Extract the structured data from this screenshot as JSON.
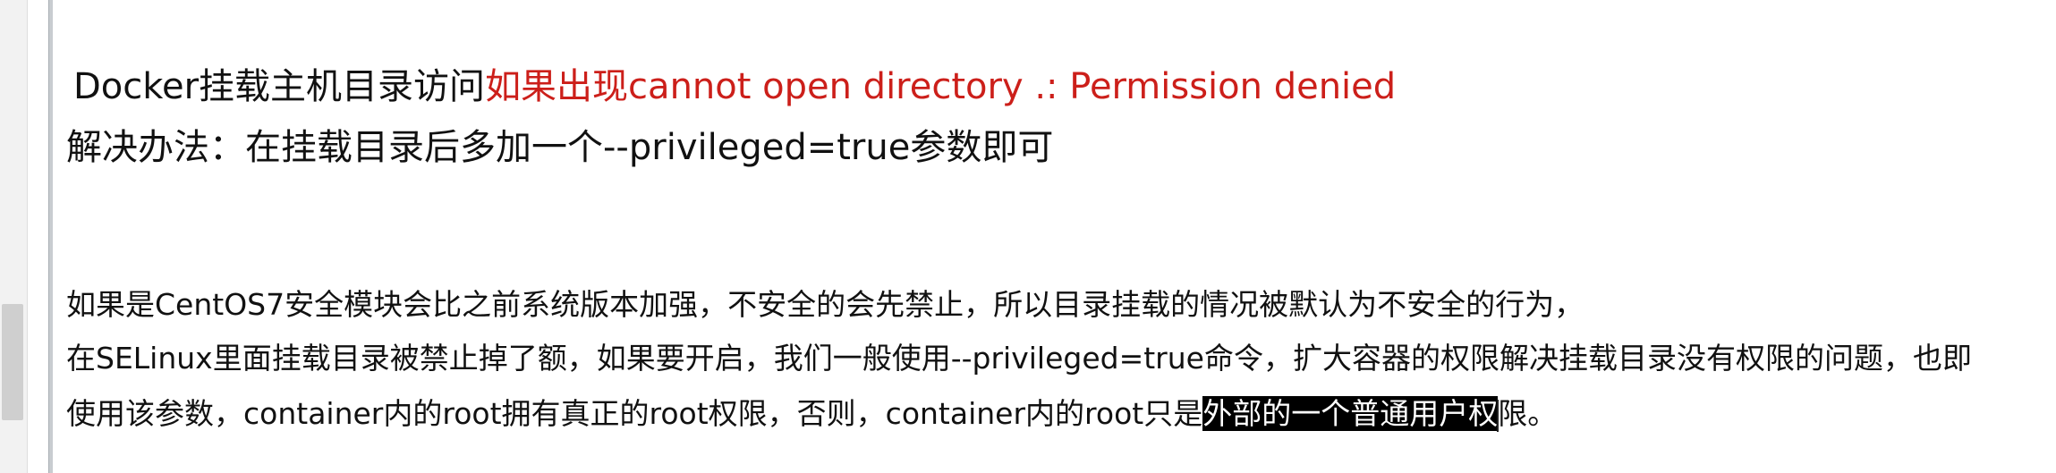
{
  "doc": {
    "heading_prefix": "Docker挂载主机目录访问",
    "heading_red": "如果出现cannot open directory .: Permission denied",
    "solution": "解决办法：在挂载目录后多加一个--privileged=true参数即可",
    "para_line1": "如果是CentOS7安全模块会比之前系统版本加强，不安全的会先禁止，所以目录挂载的情况被默认为不安全的行为，",
    "para_line2": "在SELinux里面挂载目录被禁止掉了额，如果要开启，我们一般使用--privileged=true命令，扩大容器的权限解决挂载目录没有权限的问题，也即",
    "para_line3_before": "使用该参数，container内的root拥有真正的root权限，否则，container内的root只是",
    "para_line3_selected": "外部的一个普通用户权",
    "para_line3_after": "限。"
  },
  "colors": {
    "red_text": "#cc1f1a",
    "selection_bg": "#000000"
  }
}
